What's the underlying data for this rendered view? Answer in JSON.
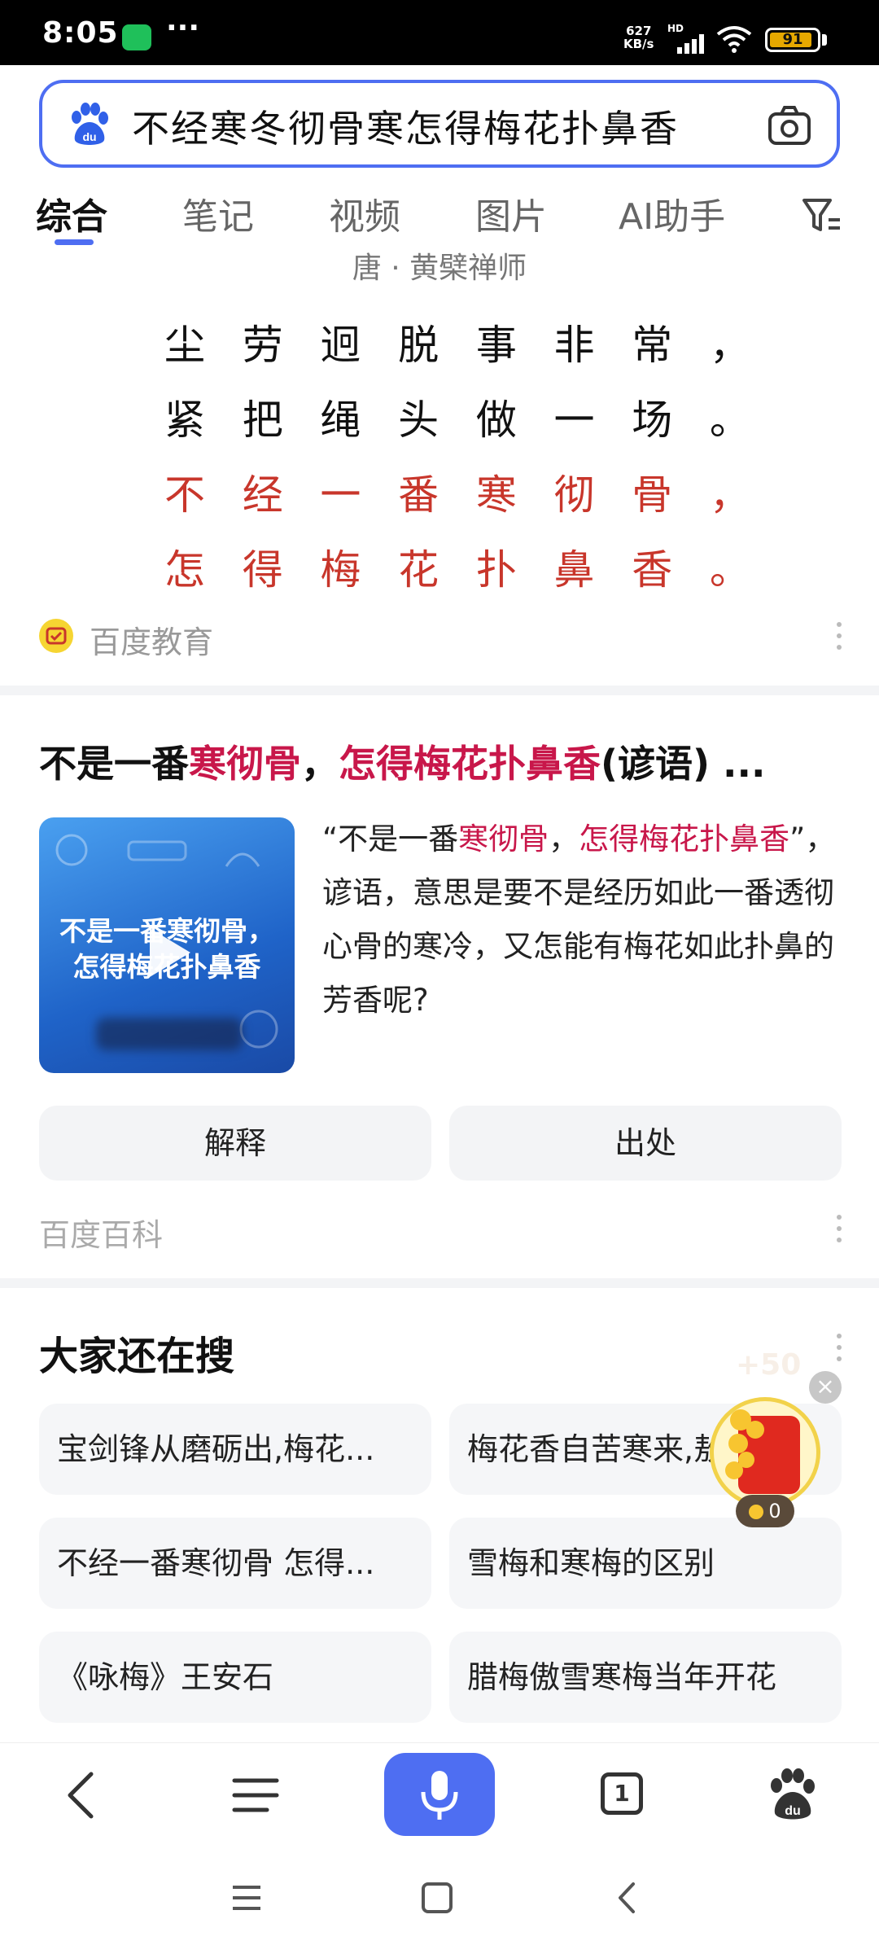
{
  "status_bar": {
    "time": "8:05",
    "dots": "···",
    "net_speed_value": "627",
    "net_speed_unit": "KB/s",
    "hd": "HD",
    "battery": "91",
    "battery_level_percent": 91,
    "battery_color": "#e6a800"
  },
  "search": {
    "query": "不经寒冬彻骨寒怎得梅花扑鼻香",
    "accent_color": "#4e6ef2"
  },
  "tabs": [
    {
      "label": "综合",
      "active": true
    },
    {
      "label": "笔记"
    },
    {
      "label": "视频"
    },
    {
      "label": "图片"
    },
    {
      "label": "AI助手"
    }
  ],
  "poem": {
    "author": "唐 · 黄檗禅师",
    "lines": [
      {
        "chars": [
          "尘",
          "劳",
          "迥",
          "脱",
          "事",
          "非",
          "常",
          "，"
        ],
        "highlight": false
      },
      {
        "chars": [
          "紧",
          "把",
          "绳",
          "头",
          "做",
          "一",
          "场",
          "。"
        ],
        "highlight": false
      },
      {
        "chars": [
          "不",
          "经",
          "一",
          "番",
          "寒",
          "彻",
          "骨",
          "，"
        ],
        "highlight": true
      },
      {
        "chars": [
          "怎",
          "得",
          "梅",
          "花",
          "扑",
          "鼻",
          "香",
          "。"
        ],
        "highlight": true
      }
    ],
    "highlight_color": "#c8362b",
    "source": "百度教育"
  },
  "result": {
    "title_parts": [
      {
        "text": "不是一番",
        "hl": false
      },
      {
        "text": "寒彻骨",
        "hl": true
      },
      {
        "text": "，",
        "hl": false
      },
      {
        "text": "怎得梅花扑鼻香",
        "hl": true
      },
      {
        "text": "(谚语) ...",
        "hl": false
      }
    ],
    "thumbnail_text_line1": "不是一番寒彻骨，",
    "thumbnail_text_line2": "怎得梅花扑鼻香",
    "snippet_parts": [
      {
        "text": "“不是一番",
        "hl": false
      },
      {
        "text": "寒彻骨",
        "hl": true
      },
      {
        "text": "，",
        "hl": false
      },
      {
        "text": "怎得梅花扑鼻香",
        "hl": true
      },
      {
        "text": "”，谚语，意思是要不是经历如此一番透彻心骨的寒冷，又怎能有梅花如此扑鼻的芳香呢?",
        "hl": false
      }
    ],
    "buttons": [
      "解释",
      "出处"
    ],
    "source": "百度百科",
    "highlight_color": "#c8174a"
  },
  "also_search": {
    "title": "大家还在搜",
    "items": [
      "宝剑锋从磨砺出,梅花...",
      "梅花香自苦寒来,敖...",
      "不经一番寒彻骨 怎得...",
      "雪梅和寒梅的区别",
      "《咏梅》王安石",
      "腊梅傲雪寒梅当年开花"
    ]
  },
  "floating_reward": {
    "plus_text": "+50",
    "close_label": "×",
    "coin_count": "0"
  },
  "bottom_nav": {
    "tab_count": "1"
  }
}
